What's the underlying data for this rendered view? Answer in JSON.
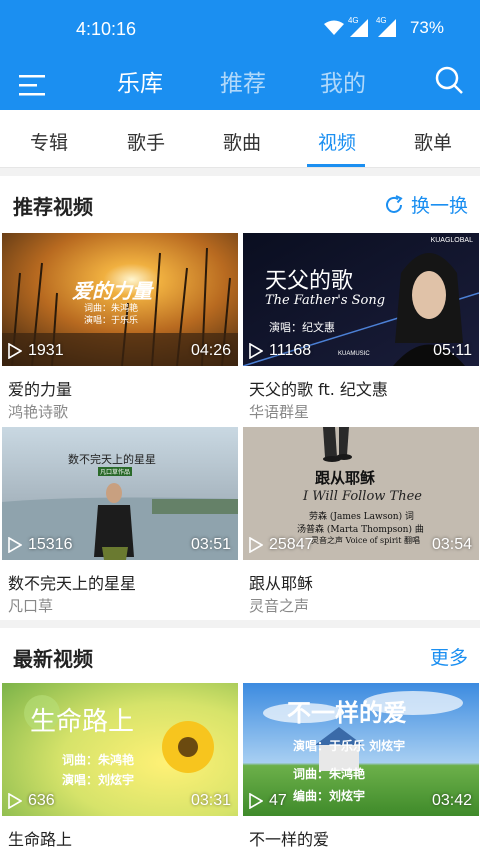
{
  "statusbar": {
    "time": "4:10:16",
    "net1": "4G",
    "net2": "4G",
    "battery": "73%"
  },
  "topnav": {
    "tabs": [
      "乐库",
      "推荐",
      "我的"
    ]
  },
  "subtabs": [
    "专辑",
    "歌手",
    "歌曲",
    "视频",
    "歌单"
  ],
  "recommended": {
    "title": "推荐视频",
    "action": "换一换",
    "videos": [
      {
        "title": "爱的力量",
        "artist": "鸿艳诗歌",
        "plays": "1931",
        "duration": "04:26",
        "overlay_title": "爱的力量",
        "overlay_l1": "词曲：朱鸿艳",
        "overlay_l2": "演唱：于乐乐"
      },
      {
        "title": "天父的歌 ft. 纪文惠",
        "artist": "华语群星",
        "plays": "11168",
        "duration": "05:11",
        "overlay_title": "天父的歌",
        "overlay_en": "The Father's Song",
        "overlay_singer": "演唱：纪文惠",
        "brand": "KUAGLOBAL",
        "brand2": "KUAMUSIC"
      },
      {
        "title": "数不完天上的星星",
        "artist": "凡口草",
        "plays": "15316",
        "duration": "03:51",
        "overlay_title": "数不完天上的星星",
        "overlay_sub": "凡口草作品"
      },
      {
        "title": "跟从耶稣",
        "artist": "灵音之声",
        "plays": "25847",
        "duration": "03:54",
        "overlay_title": "跟从耶稣",
        "overlay_en": "I Will Follow Thee",
        "overlay_l1": "劳森 (James Lawson) 词",
        "overlay_l2": "汤普森 (Marta Thompson) 曲",
        "overlay_l3": "灵音之声 Voice of spirit 翻唱"
      }
    ]
  },
  "latest": {
    "title": "最新视频",
    "action": "更多",
    "videos": [
      {
        "title": "生命路上",
        "plays": "636",
        "duration": "03:31",
        "overlay_title": "生命路上",
        "overlay_l1": "词曲：朱鸿艳",
        "overlay_l2": "演唱：刘炫宇"
      },
      {
        "title": "不一样的爱",
        "plays": "47",
        "duration": "03:42",
        "overlay_title": "不一样的爱",
        "overlay_l1": "演唱：于乐乐 刘炫宇",
        "overlay_l2": "词曲：朱鸿艳",
        "overlay_l3": "编曲：刘炫宇"
      }
    ]
  },
  "colors": {
    "primary": "#1b8ff1",
    "text": "#222222",
    "muted": "#888888"
  },
  "icons": [
    "menu-icon",
    "search-icon",
    "refresh-icon",
    "play-icon",
    "wifi-icon",
    "signal-icon",
    "battery-icon"
  ]
}
